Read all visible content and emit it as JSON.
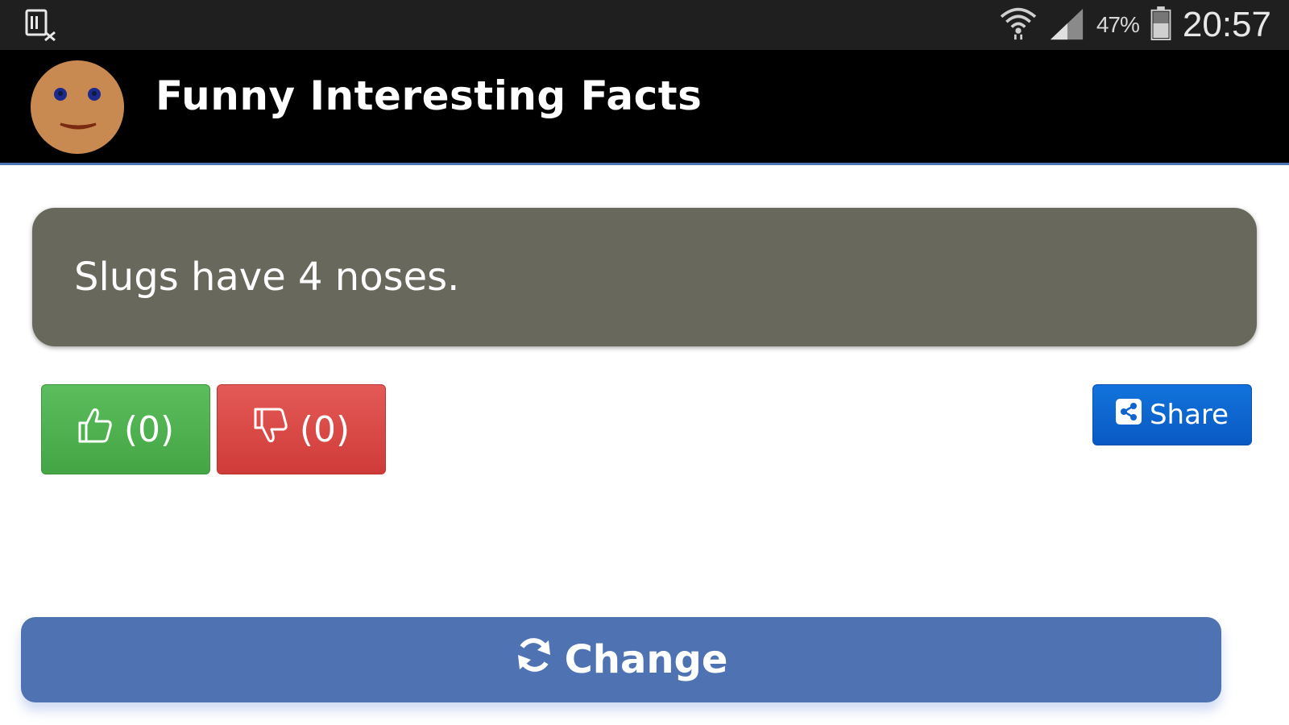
{
  "status_bar": {
    "left_icon": "screenshot-notification-icon",
    "wifi_icon": "wifi-icon",
    "signal_icon": "cell-signal-icon",
    "battery_percent": "47%",
    "battery_icon": "battery-icon",
    "time": "20:57"
  },
  "app_bar": {
    "title": "Funny Interesting Facts",
    "logo_icon": "smiley-face-logo"
  },
  "fact": {
    "text": "Slugs have 4 noses."
  },
  "actions": {
    "like_count": "(0)",
    "dislike_count": "(0)",
    "share_label": "Share",
    "change_label": "Change"
  },
  "colors": {
    "card_bg": "#69685c",
    "like": "#4cae4c",
    "dislike": "#d9534f",
    "share": "#0d63cf",
    "change": "#4e72b2",
    "accent_line": "#4f74b3"
  }
}
